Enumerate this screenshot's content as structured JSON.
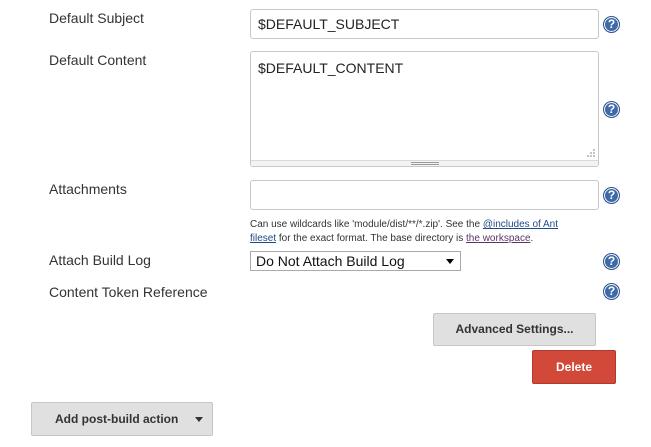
{
  "form": {
    "default_subject": {
      "label": "Default Subject",
      "value": "$DEFAULT_SUBJECT"
    },
    "default_content": {
      "label": "Default Content",
      "value": "$DEFAULT_CONTENT"
    },
    "attachments": {
      "label": "Attachments",
      "value": "",
      "hint_prefix": "Can use wildcards like 'module/dist/**/*.zip'. See the ",
      "hint_link1_part1": "@includes of Ant",
      "hint_link1_part2": "fileset",
      "hint_middle": " for the exact format. The base directory is ",
      "hint_link2": "the workspace",
      "hint_suffix": "."
    },
    "attach_build_log": {
      "label": "Attach Build Log",
      "selected": "Do Not Attach Build Log"
    },
    "content_token_reference": {
      "label": "Content Token Reference"
    }
  },
  "help_icon_glyph": "?",
  "buttons": {
    "advanced_settings": "Advanced Settings...",
    "delete": "Delete",
    "add_post_build_action": "Add post-build action"
  },
  "colors": {
    "help_icon": "#3f6aa8",
    "delete_button": "#d24939",
    "link": "#204a87"
  },
  "icons": {
    "help": "help-icon",
    "dropdown": "chevron-down-icon",
    "resize": "resize-grip-icon"
  }
}
